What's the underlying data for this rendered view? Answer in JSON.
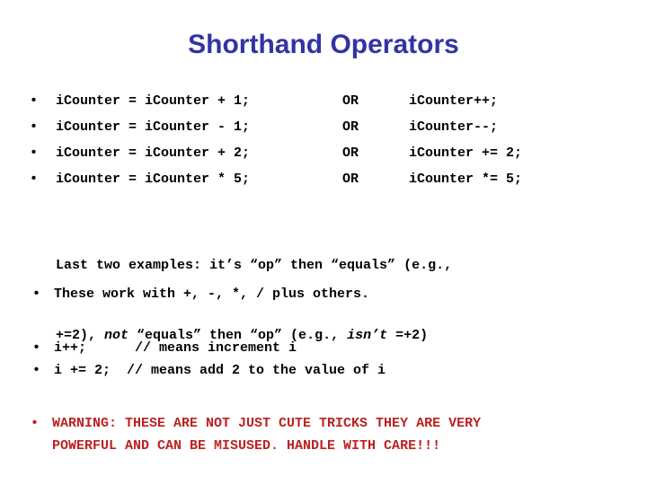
{
  "slide": {
    "title": "Shorthand Operators",
    "title_color": "#3333a6",
    "background_color": "#ffffff",
    "body_color": "#000000",
    "warning_color": "#bb2222",
    "bullet_glyph": "•"
  },
  "operator_table": {
    "rows": [
      {
        "bullet": "•",
        "longhand": "iCounter = iCounter + 1;",
        "connector": "OR",
        "shorthand": "iCounter++;"
      },
      {
        "bullet": "•",
        "longhand": "iCounter = iCounter - 1;",
        "connector": "OR",
        "shorthand": "iCounter--;"
      },
      {
        "bullet": "•",
        "longhand": "iCounter = iCounter + 2;",
        "connector": "OR",
        "shorthand": "iCounter += 2;"
      },
      {
        "bullet": "•",
        "longhand": "iCounter = iCounter * 5;",
        "connector": "OR",
        "shorthand": "iCounter *= 5;"
      }
    ]
  },
  "note": {
    "line1_prefix": "Last two examples: it’s “op” then “equals” (e.g.,",
    "line2_prefix": "+=2), ",
    "line2_italic1": "not",
    "line2_mid": " “equals” then “op” (e.g., ",
    "line2_italic2": "isn’t",
    "line2_suffix": " =+2)"
  },
  "bullets": {
    "these_work": {
      "bullet": "•",
      "text": "These work with +, -, *, / plus others."
    },
    "increment": {
      "bullet": "•",
      "text": "i++;      // means increment i"
    },
    "add_two": {
      "bullet": "•",
      "text": "i += 2;  // means add 2 to the value of i"
    }
  },
  "warning": {
    "bullet": "•",
    "line1": "WARNING: THESE ARE NOT JUST CUTE TRICKS THEY ARE VERY",
    "line2": "POWERFUL AND CAN BE MISUSED. HANDLE WITH CARE!!!"
  }
}
